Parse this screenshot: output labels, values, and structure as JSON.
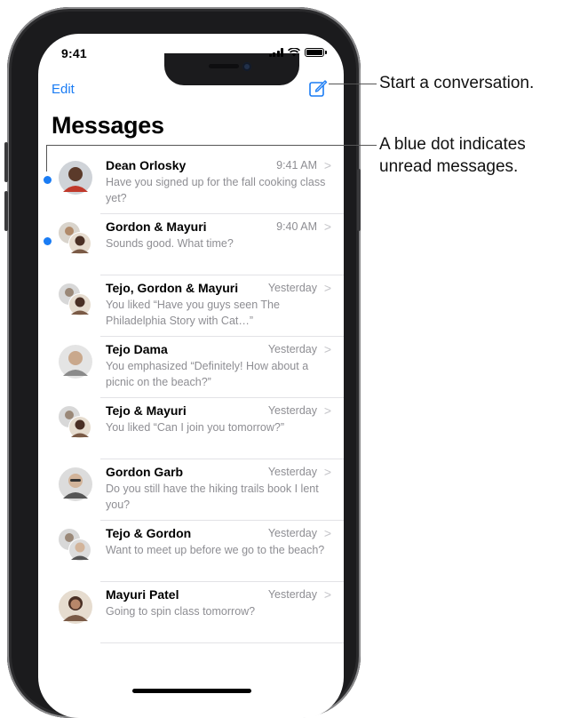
{
  "status_bar": {
    "time": "9:41"
  },
  "nav": {
    "edit_label": "Edit",
    "compose_icon": "compose-icon"
  },
  "title": "Messages",
  "accent_color": "#1a7cf4",
  "conversations": [
    {
      "name": "Dean Orlosky",
      "time": "9:41 AM",
      "preview": "Have you signed up for the fall cooking class yet?",
      "unread": true
    },
    {
      "name": "Gordon & Mayuri",
      "time": "9:40 AM",
      "preview": "Sounds good. What time?",
      "unread": true
    },
    {
      "name": "Tejo, Gordon & Mayuri",
      "time": "Yesterday",
      "preview": "You liked “Have you guys seen The Philadelphia Story with Cat…”",
      "unread": false
    },
    {
      "name": "Tejo Dama",
      "time": "Yesterday",
      "preview": "You emphasized “Definitely! How about a picnic on the beach?”",
      "unread": false
    },
    {
      "name": "Tejo & Mayuri",
      "time": "Yesterday",
      "preview": "You liked “Can I join you tomorrow?”",
      "unread": false
    },
    {
      "name": "Gordon Garb",
      "time": "Yesterday",
      "preview": "Do you still have the hiking trails book I lent you?",
      "unread": false
    },
    {
      "name": "Tejo & Gordon",
      "time": "Yesterday",
      "preview": "Want to meet up before we go to the beach?",
      "unread": false
    },
    {
      "name": "Mayuri Patel",
      "time": "Yesterday",
      "preview": "Going to spin class tomorrow?",
      "unread": false
    }
  ],
  "callouts": {
    "compose": "Start a conversation.",
    "unread_line1": "A blue dot indicates",
    "unread_line2": "unread messages."
  }
}
